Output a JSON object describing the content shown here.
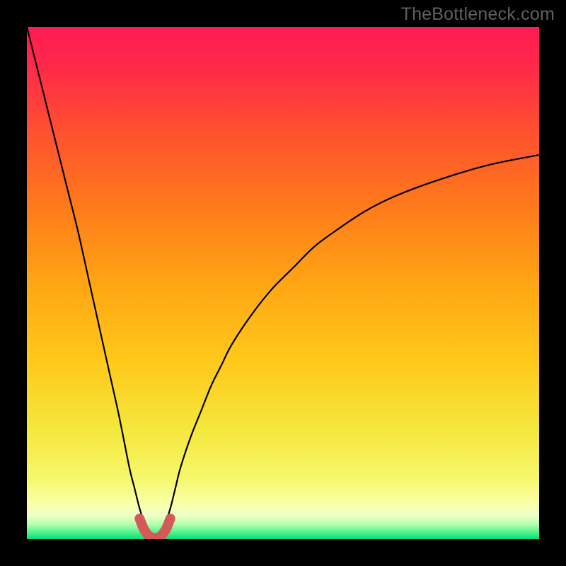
{
  "watermark": "TheBottleneck.com",
  "gradient": {
    "stops": [
      {
        "offset": 0.0,
        "color": "#ff1a55"
      },
      {
        "offset": 0.08,
        "color": "#ff2a48"
      },
      {
        "offset": 0.2,
        "color": "#ff4f30"
      },
      {
        "offset": 0.35,
        "color": "#ff7a1a"
      },
      {
        "offset": 0.5,
        "color": "#ffa514"
      },
      {
        "offset": 0.65,
        "color": "#ffc81a"
      },
      {
        "offset": 0.78,
        "color": "#f5e63a"
      },
      {
        "offset": 0.88,
        "color": "#f6f76a"
      },
      {
        "offset": 0.93,
        "color": "#faffa8"
      },
      {
        "offset": 0.955,
        "color": "#ecffc8"
      },
      {
        "offset": 0.97,
        "color": "#b8ffb0"
      },
      {
        "offset": 0.985,
        "color": "#5cf590"
      },
      {
        "offset": 1.0,
        "color": "#00e27a"
      }
    ]
  },
  "chart_data": {
    "type": "line",
    "title": "",
    "xlabel": "",
    "ylabel": "",
    "xlim": [
      0,
      100
    ],
    "ylim": [
      0,
      100
    ],
    "x_optimum": 25,
    "series": [
      {
        "name": "bottleneck-curve",
        "description": "Absolute-difference-style bottleneck curve with minimum (0%) near x≈25 rising steeply toward both sides; left branch starts near 100% at x=0, right branch rises with diminishing slope to ≈75% at x=100.",
        "x": [
          0,
          2,
          4,
          6,
          8,
          10,
          12,
          14,
          16,
          18,
          20,
          21,
          22,
          23,
          24,
          25,
          26,
          27,
          28,
          29,
          30,
          32,
          34,
          36,
          38,
          40,
          44,
          48,
          52,
          56,
          60,
          66,
          72,
          80,
          90,
          100
        ],
        "y": [
          100,
          92,
          84,
          76,
          68,
          60,
          51,
          42,
          33,
          24,
          14,
          10,
          6,
          3,
          1,
          0,
          1,
          3,
          6,
          10,
          14,
          20,
          25,
          30,
          34,
          38,
          44,
          49,
          53,
          57,
          60,
          64,
          67,
          70,
          73,
          75
        ]
      }
    ],
    "markers": {
      "name": "optimum-band",
      "color": "#d45a5a",
      "description": "Rounded marker cluster at the curve's minimum",
      "points": [
        {
          "x": 22.0,
          "y": 4.0
        },
        {
          "x": 22.8,
          "y": 2.0
        },
        {
          "x": 23.6,
          "y": 0.8
        },
        {
          "x": 24.5,
          "y": 0.2
        },
        {
          "x": 25.5,
          "y": 0.2
        },
        {
          "x": 26.4,
          "y": 0.8
        },
        {
          "x": 27.2,
          "y": 2.0
        },
        {
          "x": 28.0,
          "y": 4.0
        }
      ]
    }
  }
}
